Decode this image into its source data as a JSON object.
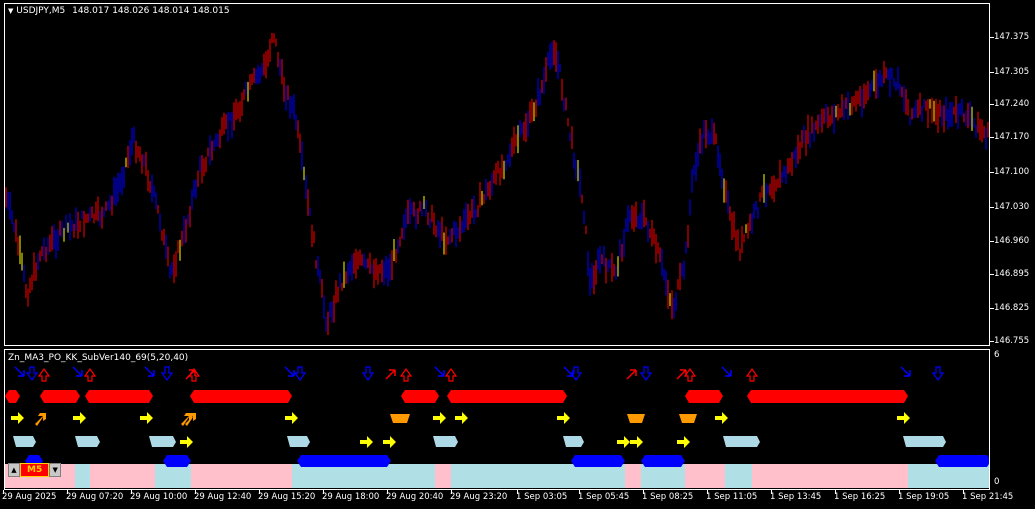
{
  "chart": {
    "symbol_header": "USDJPY,M5",
    "ohlc_text": "148.017 148.026 148.014 148.015",
    "price_axis": [
      "147.375",
      "147.305",
      "147.240",
      "147.170",
      "147.100",
      "147.030",
      "146.960",
      "146.895",
      "146.825",
      "146.755"
    ],
    "time_axis": [
      "29 Aug 2025",
      "29 Aug 07:20",
      "29 Aug 10:00",
      "29 Aug 12:40",
      "29 Aug 15:20",
      "29 Aug 18:00",
      "29 Aug 20:40",
      "29 Aug 23:20",
      "1 Sep 03:05",
      "1 Sep 05:45",
      "1 Sep 08:25",
      "1 Sep 11:05",
      "1 Sep 13:45",
      "1 Sep 16:25",
      "1 Sep 19:05",
      "1 Sep 21:45"
    ],
    "colors": {
      "bull": "#ff0000",
      "bear": "#0000ff",
      "doji": "#ffff00",
      "background": "#000000",
      "foreground": "#ffffff"
    }
  },
  "indicator": {
    "title": "Zn_MA3_PO_KK_SubVer140_69(5,20,40)",
    "scale_max": "6",
    "scale_min": "0",
    "colors": {
      "up": "#ff0000",
      "down": "#0000ff",
      "yellow": "#ffff00",
      "orange": "#ff9900",
      "lightblue": "#add8e6",
      "pink": "#ffc0cb",
      "cyanish": "#b0e0e6"
    }
  },
  "timeframe_panel": {
    "up_icon": "triangle-up-icon",
    "label": "M5",
    "down_icon": "triangle-down-icon"
  }
}
